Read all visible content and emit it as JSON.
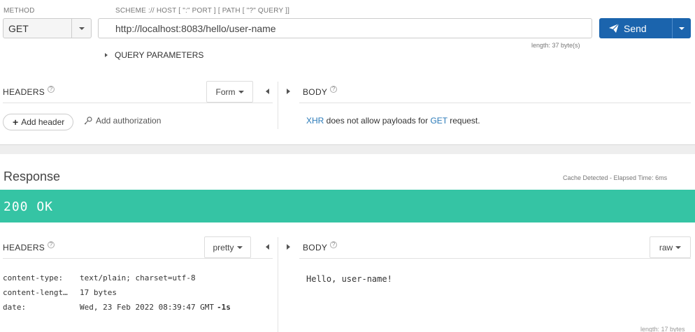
{
  "request": {
    "method_label": "METHOD",
    "method_value": "GET",
    "url_label": "SCHEME :// HOST [ \":\" PORT ] [ PATH [ \"?\" QUERY ]]",
    "url_value": "http://localhost:8083/hello/user-name",
    "length_text": "length: 37 byte(s)",
    "send_label": "Send",
    "query_params_label": "QUERY PARAMETERS"
  },
  "request_headers": {
    "title": "HEADERS",
    "mode_label": "Form",
    "add_header_label": "Add header",
    "add_authorization_label": "Add authorization"
  },
  "request_body": {
    "title": "BODY",
    "message": {
      "xhr": "XHR",
      "text1": " does not allow payloads for ",
      "method": "GET",
      "text2": " request."
    }
  },
  "response": {
    "title": "Response",
    "cache_info": "Cache Detected - Elapsed Time: 6ms",
    "status_text": "200 OK",
    "status_color": "#35c4a4",
    "headers_title": "HEADERS",
    "headers_mode": "pretty",
    "headers": [
      {
        "name": "content-type:",
        "value": "text/plain; charset=utf-8",
        "extra": ""
      },
      {
        "name": "content-lengt…",
        "value": "17 bytes",
        "extra": ""
      },
      {
        "name": "date:",
        "value": "Wed, 23 Feb 2022 08:39:47 GMT",
        "extra": "-1s"
      }
    ],
    "body_title": "BODY",
    "body_mode": "raw",
    "body_text": "Hello, user-name!",
    "body_length": "length: 17 bytes"
  },
  "colors": {
    "send_button": "#1b64ad",
    "link": "#2a7ab8"
  }
}
